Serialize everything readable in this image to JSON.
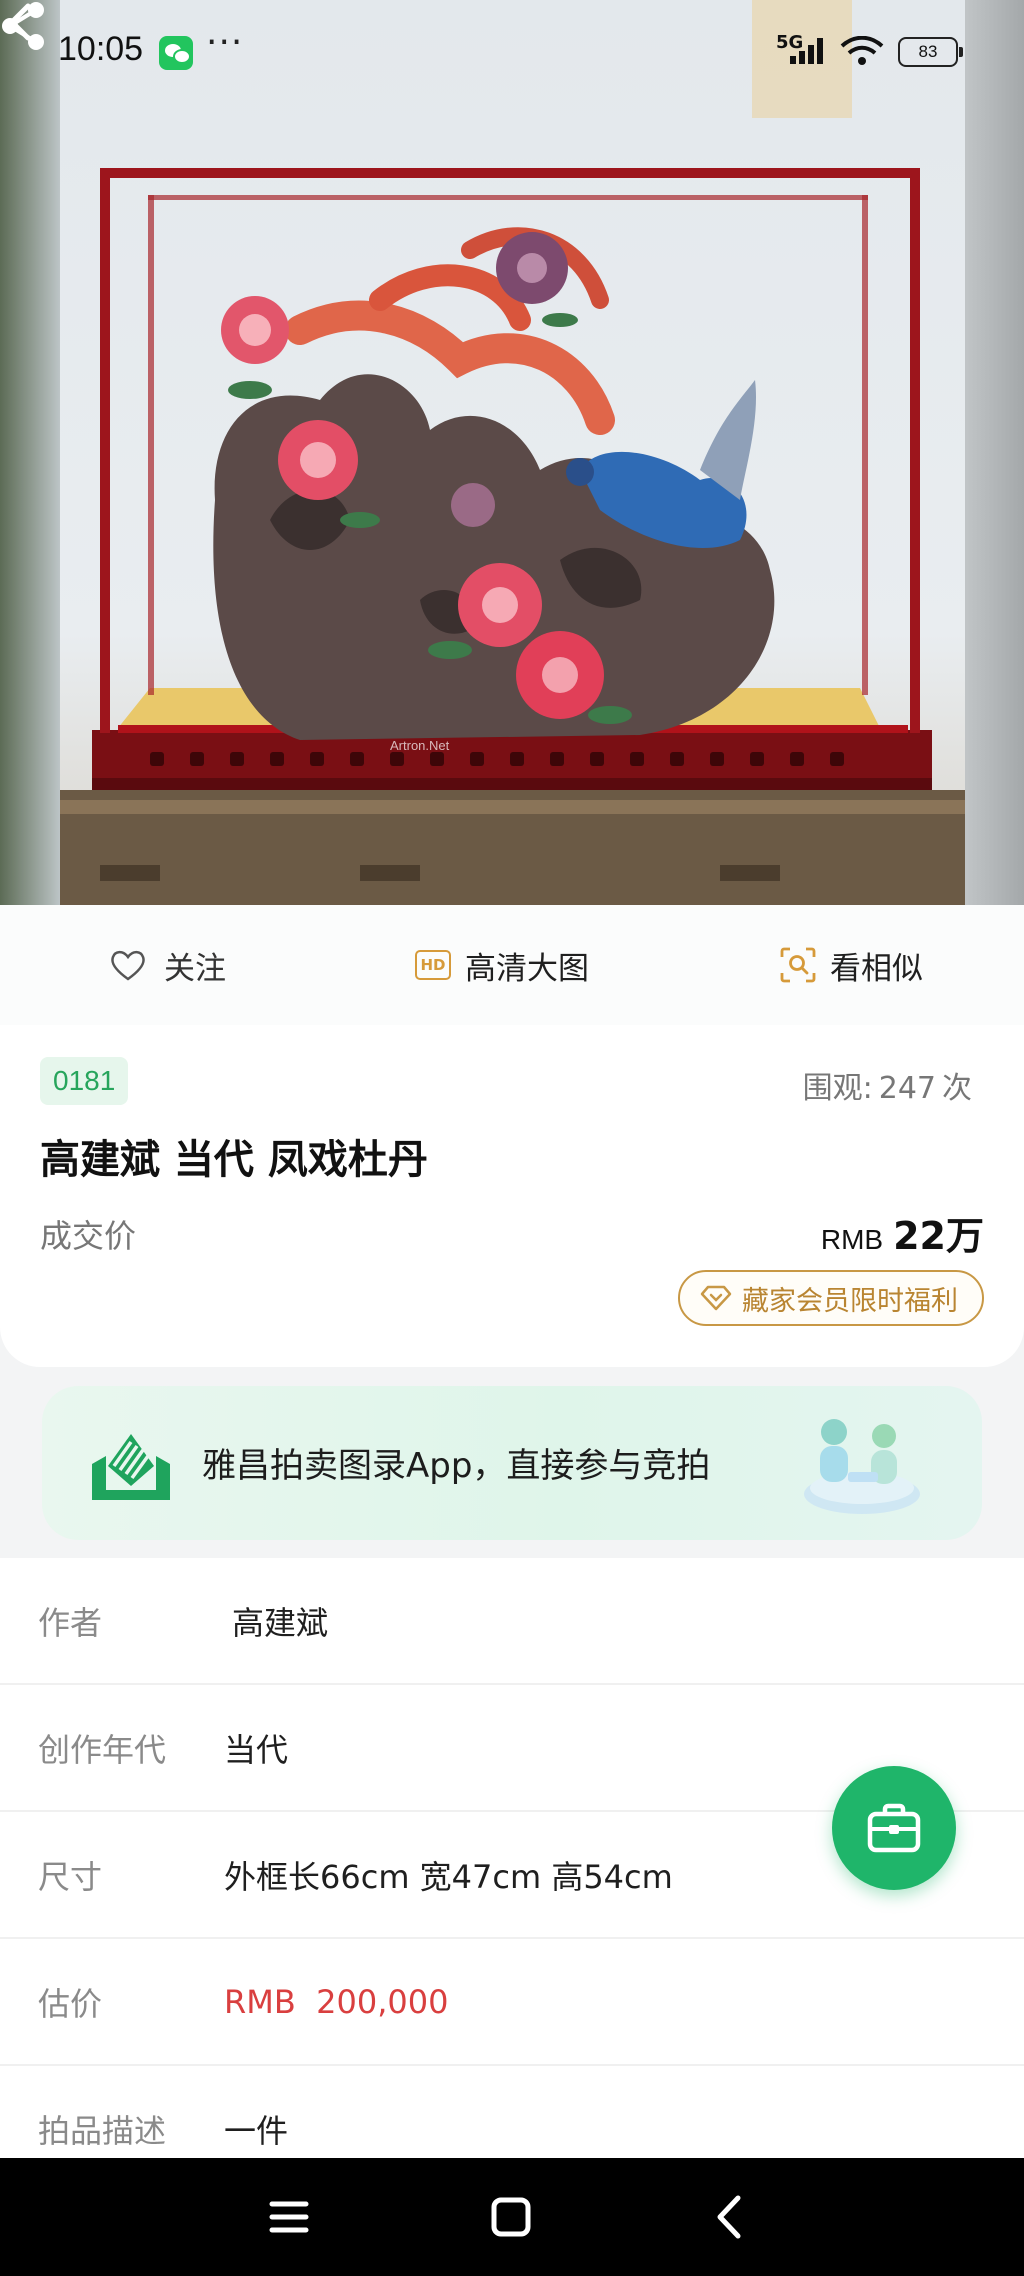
{
  "status_bar": {
    "time": "10:05",
    "more": "···",
    "network": "5G",
    "battery": "83"
  },
  "hero": {
    "watermark": "Artron.Net",
    "back_icon": "chevron-left-icon",
    "share_icon": "share-icon"
  },
  "actions": {
    "follow": "关注",
    "hd": "高清大图",
    "hd_badge": "HD",
    "similar": "看相似"
  },
  "lot": {
    "number": "0181",
    "views_label": "围观:",
    "views_count": "247",
    "views_unit": "次",
    "title": "高建斌 当代 凤戏杜丹",
    "deal_label": "成交价",
    "deal_currency": "RMB",
    "deal_amount": "22万",
    "vip_label": "藏家会员限时福利"
  },
  "banner": {
    "text": "雅昌拍卖图录App，直接参与竞拍"
  },
  "details": [
    {
      "key": "作者",
      "value": "高建斌"
    },
    {
      "key": "创作年代",
      "value": "当代"
    },
    {
      "key": "尺寸",
      "value": "外框长66cm 宽47cm 高54cm"
    },
    {
      "key": "估价",
      "value": "RMB  200,000"
    },
    {
      "key": "拍品描述",
      "value": "一件"
    }
  ],
  "colors": {
    "brand_green": "#1fb56a",
    "gold": "#c89845",
    "estimate_red": "#d93f3f"
  }
}
